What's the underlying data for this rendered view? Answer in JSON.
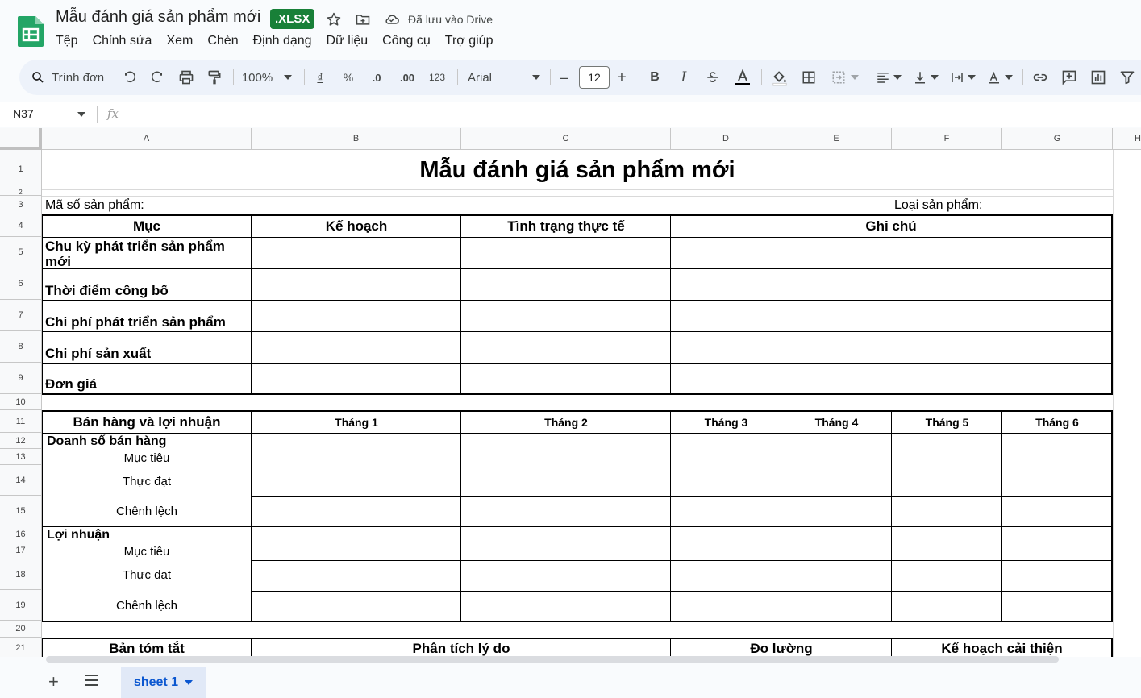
{
  "app": {
    "title": "Mẫu đánh giá sản phẩm mới",
    "file_badge": ".XLSX",
    "saved_status": "Đã lưu vào Drive",
    "icons": [
      "sheets-logo",
      "star-icon",
      "move-to-folder-icon",
      "cloud-saved-icon"
    ]
  },
  "menu": [
    "Tệp",
    "Chỉnh sửa",
    "Xem",
    "Chèn",
    "Định dạng",
    "Dữ liệu",
    "Công cụ",
    "Trợ giúp"
  ],
  "toolbar": {
    "search_label": "Trình đơn",
    "zoom": "100%",
    "currency": "₫",
    "percent": "%",
    "decrease_decimal": ".0",
    "increase_decimal": ".00",
    "number_format": "123",
    "font": "Arial",
    "font_size": "12",
    "minus": "–",
    "plus": "+",
    "bold": "B",
    "italic": "I"
  },
  "formula_bar": {
    "cell_ref": "N37",
    "fx": "fx"
  },
  "columns": [
    "A",
    "B",
    "C",
    "D",
    "E",
    "F",
    "G",
    "H"
  ],
  "rows": [
    "1",
    "2",
    "3",
    "4",
    "5",
    "6",
    "7",
    "8",
    "9",
    "10",
    "11",
    "12",
    "13",
    "14",
    "15",
    "16",
    "17",
    "18",
    "19",
    "20",
    "21"
  ],
  "sheet": {
    "title": "Mẫu đánh giá sản phẩm mới",
    "product_code_label": "Mã số sản phẩm:",
    "product_type_label": "Loại sản phẩm:",
    "plan_table": {
      "headers": [
        "Mục",
        "Kế hoạch",
        "Tình trạng thực tế",
        "Ghi chú"
      ],
      "items": [
        "Chu kỳ phát triển sản phẩm mới",
        "Thời điểm công bố",
        "Chi phí phát triển sản phẩm",
        "Chi phí sản xuất",
        "Đơn giá"
      ]
    },
    "sales_table": {
      "header": "Bán hàng và lợi nhuận",
      "months": [
        "Tháng 1",
        "Tháng 2",
        "Tháng 3",
        "Tháng 4",
        "Tháng 5",
        "Tháng 6"
      ],
      "revenue_label": "Doanh số bán hàng",
      "profit_label": "Lợi nhuận",
      "sub_items": [
        "Mục tiêu",
        "Thực đạt",
        "Chênh lệch"
      ]
    },
    "summary_table": {
      "headers": [
        "Bản tóm tắt",
        "Phân tích lý do",
        "Đo lường",
        "Kế hoạch cải thiện"
      ]
    }
  },
  "sheet_tabs": {
    "active": "sheet 1",
    "add": "+"
  }
}
